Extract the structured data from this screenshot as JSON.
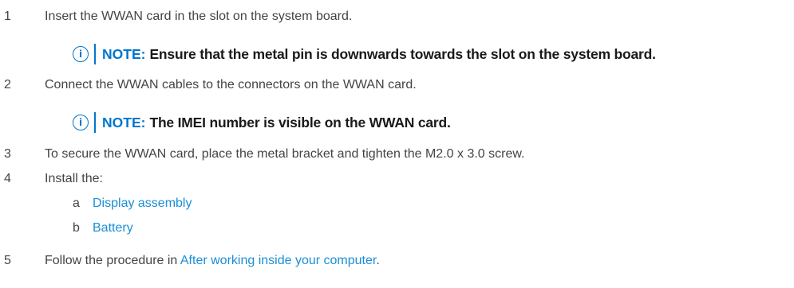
{
  "steps": [
    {
      "number": "1",
      "text": "Insert the WWAN card in the slot on the system board."
    },
    {
      "number": "2",
      "text": "Connect the WWAN cables to the connectors on the WWAN card."
    },
    {
      "number": "3",
      "text": "To secure the WWAN card, place the metal bracket and tighten the M2.0 x 3.0 screw."
    },
    {
      "number": "4",
      "text": "Install the:"
    },
    {
      "number": "5",
      "text_before": "Follow the procedure in ",
      "link": "After working inside your computer",
      "text_after": "."
    }
  ],
  "notes": [
    {
      "label": "NOTE:",
      "text": "Ensure that the metal pin is downwards towards the slot on the system board.",
      "icon": "info-circle-icon"
    },
    {
      "label": "NOTE:",
      "text": "The IMEI number is visible on the WWAN card.",
      "icon": "info-circle-icon"
    }
  ],
  "substeps": [
    {
      "letter": "a",
      "link": "Display assembly"
    },
    {
      "letter": "b",
      "link": "Battery"
    }
  ],
  "colors": {
    "accent": "#0076ce",
    "link": "#1a8fd6",
    "body_text": "#444444"
  }
}
